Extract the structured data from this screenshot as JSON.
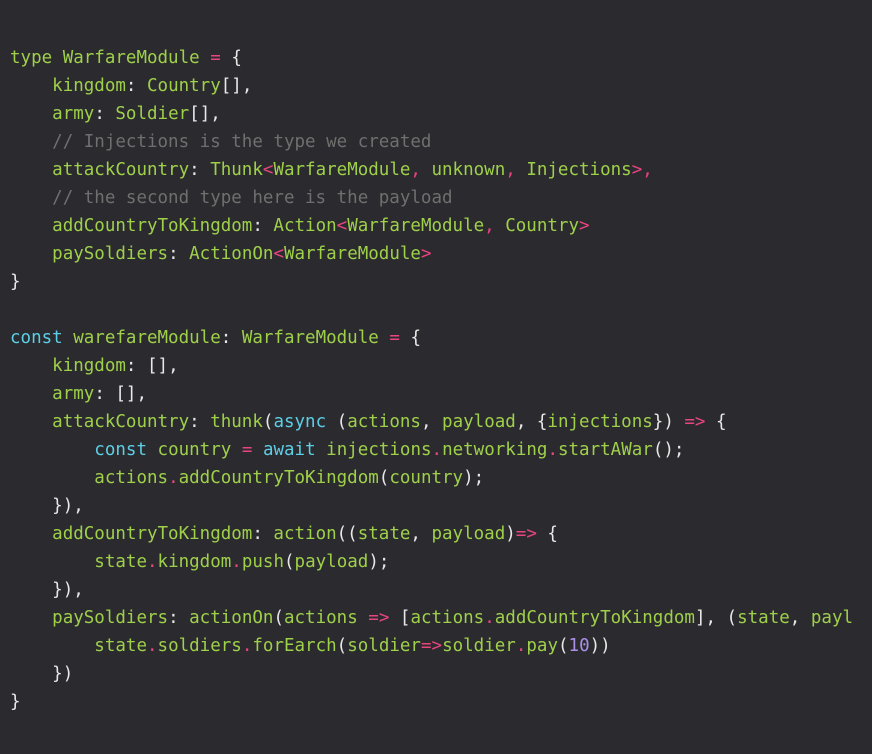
{
  "editor": {
    "kind": "code-snippet",
    "language": "typescript",
    "background_color": "#2b2b2f",
    "theme_colors": {
      "plain": "#e8e8e8",
      "green": "#9fd04a",
      "cyan": "#5ccfe6",
      "pink": "#e8447e",
      "comment": "#6f6f6f",
      "purple": "#a98fe8"
    },
    "font_size_px": 17.5,
    "line_height_px": 28,
    "lines": [
      {
        "id": "line-1",
        "tokens": [
          {
            "text": "type",
            "color": "green"
          },
          {
            "text": " ",
            "color": "plain"
          },
          {
            "text": "WarfareModule",
            "color": "green"
          },
          {
            "text": " ",
            "color": "plain"
          },
          {
            "text": "=",
            "color": "pink"
          },
          {
            "text": " ",
            "color": "plain"
          },
          {
            "text": "{",
            "color": "plain"
          }
        ]
      },
      {
        "id": "line-2",
        "tokens": [
          {
            "text": "    ",
            "color": "plain"
          },
          {
            "text": "kingdom",
            "color": "green"
          },
          {
            "text": ": ",
            "color": "plain"
          },
          {
            "text": "Country",
            "color": "green"
          },
          {
            "text": "[],",
            "color": "plain"
          }
        ]
      },
      {
        "id": "line-3",
        "tokens": [
          {
            "text": "    ",
            "color": "plain"
          },
          {
            "text": "army",
            "color": "green"
          },
          {
            "text": ": ",
            "color": "plain"
          },
          {
            "text": "Soldier",
            "color": "green"
          },
          {
            "text": "[],",
            "color": "plain"
          }
        ]
      },
      {
        "id": "line-4",
        "tokens": [
          {
            "text": "    ",
            "color": "plain"
          },
          {
            "text": "// Injections is the type we created",
            "color": "comment"
          }
        ]
      },
      {
        "id": "line-5",
        "tokens": [
          {
            "text": "    ",
            "color": "plain"
          },
          {
            "text": "attackCountry",
            "color": "green"
          },
          {
            "text": ": ",
            "color": "plain"
          },
          {
            "text": "Thunk",
            "color": "green"
          },
          {
            "text": "<",
            "color": "pink"
          },
          {
            "text": "WarfareModule",
            "color": "green"
          },
          {
            "text": ", ",
            "color": "pink"
          },
          {
            "text": "unknown",
            "color": "green"
          },
          {
            "text": ", ",
            "color": "pink"
          },
          {
            "text": "Injections",
            "color": "green"
          },
          {
            "text": ">,",
            "color": "pink"
          }
        ]
      },
      {
        "id": "line-6",
        "tokens": [
          {
            "text": "    ",
            "color": "plain"
          },
          {
            "text": "// the second type here is the payload",
            "color": "comment"
          }
        ]
      },
      {
        "id": "line-7",
        "tokens": [
          {
            "text": "    ",
            "color": "plain"
          },
          {
            "text": "addCountryToKingdom",
            "color": "green"
          },
          {
            "text": ": ",
            "color": "plain"
          },
          {
            "text": "Action",
            "color": "green"
          },
          {
            "text": "<",
            "color": "pink"
          },
          {
            "text": "WarfareModule",
            "color": "green"
          },
          {
            "text": ", ",
            "color": "pink"
          },
          {
            "text": "Country",
            "color": "green"
          },
          {
            "text": ">",
            "color": "pink"
          }
        ]
      },
      {
        "id": "line-8",
        "tokens": [
          {
            "text": "    ",
            "color": "plain"
          },
          {
            "text": "paySoldiers",
            "color": "green"
          },
          {
            "text": ": ",
            "color": "plain"
          },
          {
            "text": "ActionOn",
            "color": "green"
          },
          {
            "text": "<",
            "color": "pink"
          },
          {
            "text": "WarfareModule",
            "color": "green"
          },
          {
            "text": ">",
            "color": "pink"
          }
        ]
      },
      {
        "id": "line-9",
        "tokens": [
          {
            "text": "}",
            "color": "plain"
          }
        ]
      },
      {
        "id": "line-10",
        "tokens": []
      },
      {
        "id": "line-11",
        "tokens": [
          {
            "text": "const",
            "color": "cyan"
          },
          {
            "text": " ",
            "color": "plain"
          },
          {
            "text": "warefareModule",
            "color": "green"
          },
          {
            "text": ": ",
            "color": "plain"
          },
          {
            "text": "WarfareModule",
            "color": "green"
          },
          {
            "text": " ",
            "color": "plain"
          },
          {
            "text": "=",
            "color": "pink"
          },
          {
            "text": " ",
            "color": "plain"
          },
          {
            "text": "{",
            "color": "plain"
          }
        ]
      },
      {
        "id": "line-12",
        "tokens": [
          {
            "text": "    ",
            "color": "plain"
          },
          {
            "text": "kingdom",
            "color": "green"
          },
          {
            "text": ": ",
            "color": "plain"
          },
          {
            "text": "[],",
            "color": "plain"
          }
        ]
      },
      {
        "id": "line-13",
        "tokens": [
          {
            "text": "    ",
            "color": "plain"
          },
          {
            "text": "army",
            "color": "green"
          },
          {
            "text": ": ",
            "color": "plain"
          },
          {
            "text": "[],",
            "color": "plain"
          }
        ]
      },
      {
        "id": "line-14",
        "tokens": [
          {
            "text": "    ",
            "color": "plain"
          },
          {
            "text": "attackCountry",
            "color": "green"
          },
          {
            "text": ": ",
            "color": "plain"
          },
          {
            "text": "thunk",
            "color": "green"
          },
          {
            "text": "(",
            "color": "plain"
          },
          {
            "text": "async",
            "color": "cyan"
          },
          {
            "text": " (",
            "color": "plain"
          },
          {
            "text": "actions",
            "color": "green"
          },
          {
            "text": ", ",
            "color": "plain"
          },
          {
            "text": "payload",
            "color": "green"
          },
          {
            "text": ", {",
            "color": "plain"
          },
          {
            "text": "injections",
            "color": "green"
          },
          {
            "text": "}) ",
            "color": "plain"
          },
          {
            "text": "=>",
            "color": "pink"
          },
          {
            "text": " {",
            "color": "plain"
          }
        ]
      },
      {
        "id": "line-15",
        "tokens": [
          {
            "text": "        ",
            "color": "plain"
          },
          {
            "text": "const",
            "color": "cyan"
          },
          {
            "text": " ",
            "color": "plain"
          },
          {
            "text": "country",
            "color": "green"
          },
          {
            "text": " ",
            "color": "plain"
          },
          {
            "text": "=",
            "color": "pink"
          },
          {
            "text": " ",
            "color": "plain"
          },
          {
            "text": "await",
            "color": "cyan"
          },
          {
            "text": " ",
            "color": "plain"
          },
          {
            "text": "injections",
            "color": "green"
          },
          {
            "text": ".",
            "color": "pink"
          },
          {
            "text": "networking",
            "color": "green"
          },
          {
            "text": ".",
            "color": "pink"
          },
          {
            "text": "startAWar",
            "color": "green"
          },
          {
            "text": "();",
            "color": "plain"
          }
        ]
      },
      {
        "id": "line-16",
        "tokens": [
          {
            "text": "        ",
            "color": "plain"
          },
          {
            "text": "actions",
            "color": "green"
          },
          {
            "text": ".",
            "color": "pink"
          },
          {
            "text": "addCountryToKingdom",
            "color": "green"
          },
          {
            "text": "(",
            "color": "plain"
          },
          {
            "text": "country",
            "color": "green"
          },
          {
            "text": ");",
            "color": "plain"
          }
        ]
      },
      {
        "id": "line-17",
        "tokens": [
          {
            "text": "    ",
            "color": "plain"
          },
          {
            "text": "}),",
            "color": "plain"
          }
        ]
      },
      {
        "id": "line-18",
        "tokens": [
          {
            "text": "    ",
            "color": "plain"
          },
          {
            "text": "addCountryToKingdom",
            "color": "green"
          },
          {
            "text": ": ",
            "color": "plain"
          },
          {
            "text": "action",
            "color": "green"
          },
          {
            "text": "((",
            "color": "plain"
          },
          {
            "text": "state",
            "color": "green"
          },
          {
            "text": ", ",
            "color": "plain"
          },
          {
            "text": "payload",
            "color": "green"
          },
          {
            "text": ")",
            "color": "plain"
          },
          {
            "text": "=>",
            "color": "pink"
          },
          {
            "text": " {",
            "color": "plain"
          }
        ]
      },
      {
        "id": "line-19",
        "tokens": [
          {
            "text": "        ",
            "color": "plain"
          },
          {
            "text": "state",
            "color": "green"
          },
          {
            "text": ".",
            "color": "pink"
          },
          {
            "text": "kingdom",
            "color": "green"
          },
          {
            "text": ".",
            "color": "pink"
          },
          {
            "text": "push",
            "color": "green"
          },
          {
            "text": "(",
            "color": "plain"
          },
          {
            "text": "payload",
            "color": "green"
          },
          {
            "text": ");",
            "color": "plain"
          }
        ]
      },
      {
        "id": "line-20",
        "tokens": [
          {
            "text": "    ",
            "color": "plain"
          },
          {
            "text": "}),",
            "color": "plain"
          }
        ]
      },
      {
        "id": "line-21",
        "tokens": [
          {
            "text": "    ",
            "color": "plain"
          },
          {
            "text": "paySoldiers",
            "color": "green"
          },
          {
            "text": ": ",
            "color": "plain"
          },
          {
            "text": "actionOn",
            "color": "green"
          },
          {
            "text": "(",
            "color": "plain"
          },
          {
            "text": "actions",
            "color": "green"
          },
          {
            "text": " ",
            "color": "plain"
          },
          {
            "text": "=>",
            "color": "pink"
          },
          {
            "text": " [",
            "color": "plain"
          },
          {
            "text": "actions",
            "color": "green"
          },
          {
            "text": ".",
            "color": "pink"
          },
          {
            "text": "addCountryToKingdom",
            "color": "green"
          },
          {
            "text": "], (",
            "color": "plain"
          },
          {
            "text": "state",
            "color": "green"
          },
          {
            "text": ", ",
            "color": "plain"
          },
          {
            "text": "payl",
            "color": "green"
          }
        ]
      },
      {
        "id": "line-22",
        "tokens": [
          {
            "text": "        ",
            "color": "plain"
          },
          {
            "text": "state",
            "color": "green"
          },
          {
            "text": ".",
            "color": "pink"
          },
          {
            "text": "soldiers",
            "color": "green"
          },
          {
            "text": ".",
            "color": "pink"
          },
          {
            "text": "forEarch",
            "color": "green"
          },
          {
            "text": "(",
            "color": "plain"
          },
          {
            "text": "soldier",
            "color": "green"
          },
          {
            "text": "=>",
            "color": "pink"
          },
          {
            "text": "soldier",
            "color": "green"
          },
          {
            "text": ".",
            "color": "pink"
          },
          {
            "text": "pay",
            "color": "green"
          },
          {
            "text": "(",
            "color": "plain"
          },
          {
            "text": "10",
            "color": "purple"
          },
          {
            "text": "))",
            "color": "plain"
          }
        ]
      },
      {
        "id": "line-23",
        "tokens": [
          {
            "text": "    ",
            "color": "plain"
          },
          {
            "text": "})",
            "color": "plain"
          }
        ]
      },
      {
        "id": "line-24",
        "tokens": [
          {
            "text": "}",
            "color": "plain"
          }
        ]
      }
    ]
  }
}
